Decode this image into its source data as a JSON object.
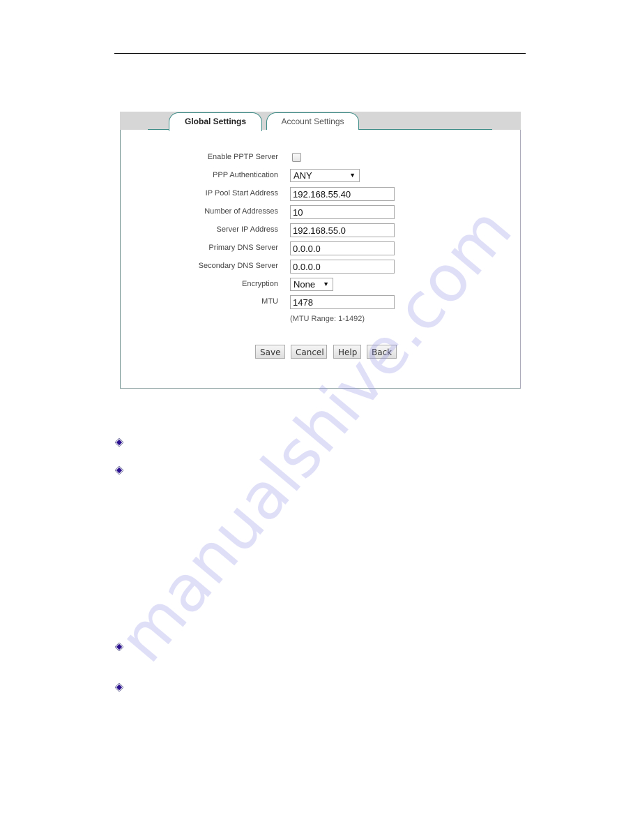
{
  "tabs": [
    {
      "label": "Global Settings",
      "active": true
    },
    {
      "label": "Account Settings",
      "active": false
    }
  ],
  "form": {
    "enable_pptp": {
      "label": "Enable PPTP Server",
      "checked": false
    },
    "ppp_auth": {
      "label": "PPP Authentication",
      "value": "ANY"
    },
    "ip_pool_start": {
      "label": "IP Pool Start Address",
      "value": "192.168.55.40"
    },
    "num_addresses": {
      "label": "Number of Addresses",
      "value": "10"
    },
    "server_ip": {
      "label": "Server IP Address",
      "value": "192.168.55.0"
    },
    "primary_dns": {
      "label": "Primary DNS Server",
      "value": "0.0.0.0"
    },
    "secondary_dns": {
      "label": "Secondary DNS Server",
      "value": "0.0.0.0"
    },
    "encryption": {
      "label": "Encryption",
      "value": "None"
    },
    "mtu": {
      "label": "MTU",
      "value": "1478",
      "hint": "(MTU Range: 1-1492)"
    }
  },
  "buttons": {
    "save": "Save",
    "cancel": "Cancel",
    "help": "Help",
    "back": "Back"
  },
  "icons": {
    "dropdown_arrow": "▼"
  },
  "bullets": [
    "diamond-bullet",
    "diamond-bullet",
    "diamond-bullet",
    "diamond-bullet"
  ],
  "watermark": "manualshive.com",
  "colors": {
    "tab_border": "#3d8b86",
    "tab_strip": "#d6d6d6",
    "bullet": "#2a0f8f"
  }
}
